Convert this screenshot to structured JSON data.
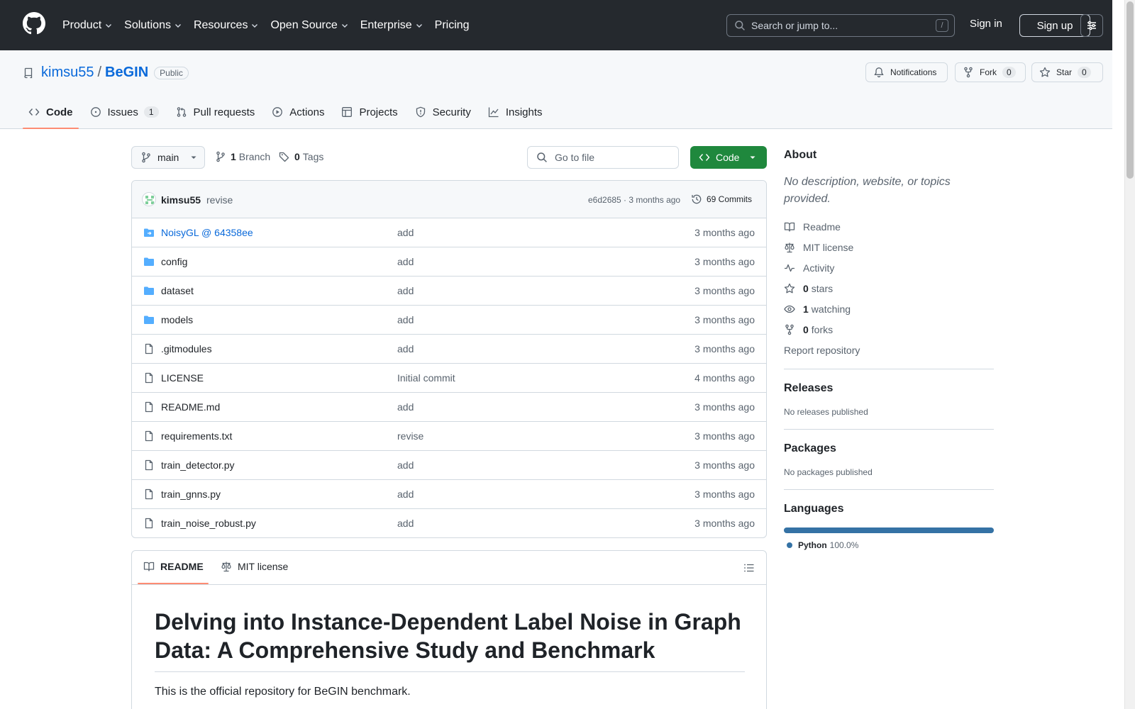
{
  "header": {
    "nav": [
      "Product",
      "Solutions",
      "Resources",
      "Open Source",
      "Enterprise",
      "Pricing"
    ],
    "search_placeholder": "Search or jump to...",
    "search_shortcut": "/",
    "signin": "Sign in",
    "signup": "Sign up"
  },
  "repo": {
    "owner": "kimsu55",
    "separator": "/",
    "name": "BeGIN",
    "visibility": "Public",
    "notifications_label": "Notifications",
    "fork_label": "Fork",
    "fork_count": "0",
    "star_label": "Star",
    "star_count": "0"
  },
  "tabs": {
    "code": "Code",
    "issues": "Issues",
    "issues_count": "1",
    "pulls": "Pull requests",
    "actions": "Actions",
    "projects": "Projects",
    "security": "Security",
    "insights": "Insights"
  },
  "filenav": {
    "branch": "main",
    "branch_count": "1",
    "branch_label": "Branch",
    "tag_count": "0",
    "tag_label": "Tags",
    "goto_placeholder": "Go to file",
    "code_button": "Code"
  },
  "commit": {
    "author": "kimsu55",
    "message": "revise",
    "meta": "e6d2685 · 3 months ago",
    "count_label": "69 Commits"
  },
  "files": [
    {
      "name": "NoisyGL @ 64358ee",
      "type": "submodule",
      "commit": "add",
      "age": "3 months ago"
    },
    {
      "name": "config",
      "type": "folder",
      "commit": "add",
      "age": "3 months ago"
    },
    {
      "name": "dataset",
      "type": "folder",
      "commit": "add",
      "age": "3 months ago"
    },
    {
      "name": "models",
      "type": "folder",
      "commit": "add",
      "age": "3 months ago"
    },
    {
      "name": ".gitmodules",
      "type": "file",
      "commit": "add",
      "age": "3 months ago"
    },
    {
      "name": "LICENSE",
      "type": "file",
      "commit": "Initial commit",
      "age": "4 months ago"
    },
    {
      "name": "README.md",
      "type": "file",
      "commit": "add",
      "age": "3 months ago"
    },
    {
      "name": "requirements.txt",
      "type": "file",
      "commit": "revise",
      "age": "3 months ago"
    },
    {
      "name": "train_detector.py",
      "type": "file",
      "commit": "add",
      "age": "3 months ago"
    },
    {
      "name": "train_gnns.py",
      "type": "file",
      "commit": "add",
      "age": "3 months ago"
    },
    {
      "name": "train_noise_robust.py",
      "type": "file",
      "commit": "add",
      "age": "3 months ago"
    }
  ],
  "readme": {
    "tab_readme": "README",
    "tab_license": "MIT license",
    "title": "Delving into Instance-Dependent Label Noise in Graph Data: A Comprehensive Study and Benchmark",
    "intro": "This is the official repository for BeGIN benchmark."
  },
  "sidebar": {
    "about_title": "About",
    "about_desc": "No description, website, or topics provided.",
    "readme": "Readme",
    "license": "MIT license",
    "activity": "Activity",
    "stars_count": "0",
    "stars_label": "stars",
    "watching_count": "1",
    "watching_label": "watching",
    "forks_count": "0",
    "forks_label": "forks",
    "report": "Report repository",
    "releases_title": "Releases",
    "releases_sub": "No releases published",
    "packages_title": "Packages",
    "packages_sub": "No packages published",
    "languages_title": "Languages",
    "language_name": "Python",
    "language_pct": "100.0%",
    "language_color": "#3572a5"
  },
  "colors": {
    "accent": "#0969da",
    "header_bg": "#25292e",
    "code_button": "#1f883d",
    "tab_underline": "#fd8c73"
  }
}
